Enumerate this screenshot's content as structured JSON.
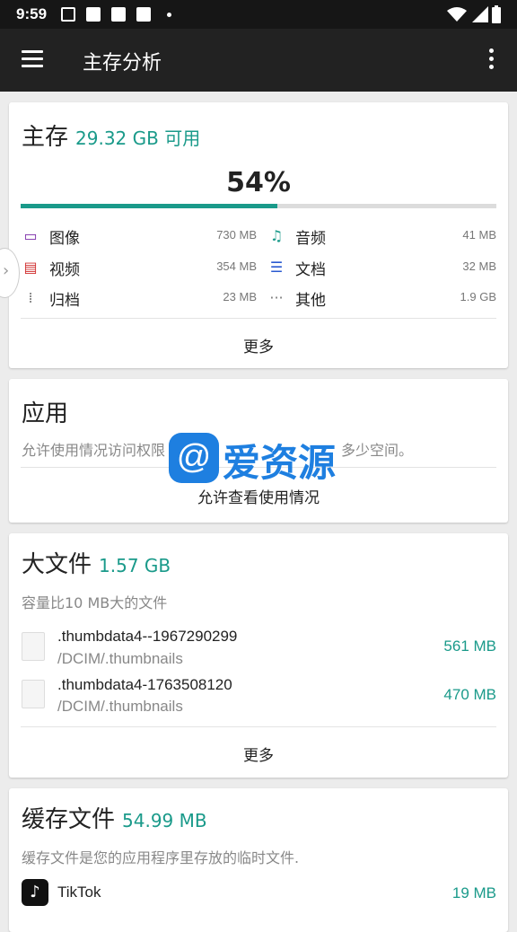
{
  "statusbar": {
    "time": "9:59"
  },
  "toolbar": {
    "title": "主存分析"
  },
  "main_storage": {
    "title": "主存",
    "available": "29.32 GB 可用",
    "percent_label": "54%",
    "percent_used": 0.54,
    "categories": [
      {
        "icon": "image-icon",
        "label": "图像",
        "size": "730 MB"
      },
      {
        "icon": "music-icon",
        "label": "音频",
        "size": "41 MB"
      },
      {
        "icon": "video-icon",
        "label": "视频",
        "size": "354 MB"
      },
      {
        "icon": "document-icon",
        "label": "文档",
        "size": "32 MB"
      },
      {
        "icon": "archive-icon",
        "label": "归档",
        "size": "23 MB"
      },
      {
        "icon": "ellipsis-icon",
        "label": "其他",
        "size": "1.9 GB"
      }
    ],
    "more_label": "更多"
  },
  "apps": {
    "title": "应用",
    "desc": "允许使用情况访问权限",
    "action": "允许查看使用情况",
    "desc_tail": "多少空间。"
  },
  "large_files": {
    "title": "大文件",
    "size": "1.57 GB",
    "desc": "容量比10 MB大的文件",
    "files": [
      {
        "name": ".thumbdata4--1967290299",
        "path": "/DCIM/.thumbnails",
        "size": "561 MB"
      },
      {
        "name": ".thumbdata4-1763508120",
        "path": "/DCIM/.thumbnails",
        "size": "470 MB"
      }
    ],
    "more_label": "更多"
  },
  "cache": {
    "title": "缓存文件",
    "size": "54.99 MB",
    "desc": "缓存文件是您的应用程序里存放的临时文件.",
    "apps": [
      {
        "name": "TikTok",
        "size": "19 MB"
      }
    ]
  },
  "watermark": {
    "text": "爱资源",
    "logo": "@"
  },
  "colors": {
    "accent": "#1a9a8a",
    "toolbar": "#222222",
    "watermark": "#1e7fe0"
  }
}
